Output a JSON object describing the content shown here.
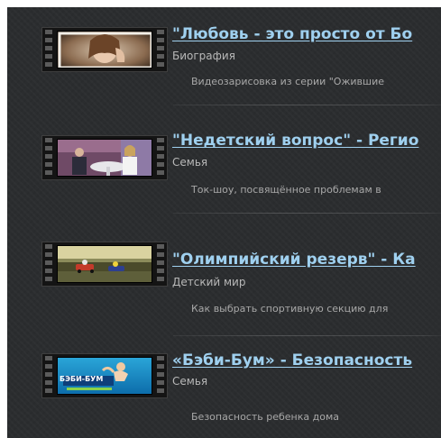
{
  "items": [
    {
      "title": "\"Любовь - это просто от Бо",
      "category": "Биография",
      "description": "Видеозарисовка из серии \"Ожившие"
    },
    {
      "title": "\"Недетский вопрос\" - Регио",
      "category": "Семья",
      "description": "Ток-шоу, посвящённое проблемам в"
    },
    {
      "title": "\"Олимпийский резерв\" - Ка",
      "category": "Детский мир",
      "description": "Как выбрать спортивную секцию для"
    },
    {
      "title": "«Бэби-Бум» - Безопасность",
      "category": "Семья",
      "description": "Безопасность ребенка дома",
      "thumbnail_text": "БЭБИ-БУМ"
    }
  ],
  "colors": {
    "background": "#2b2d2f",
    "title_link": "#9fd0ef",
    "category_text": "#b8b8b8",
    "description_text": "#a8a8a8"
  }
}
